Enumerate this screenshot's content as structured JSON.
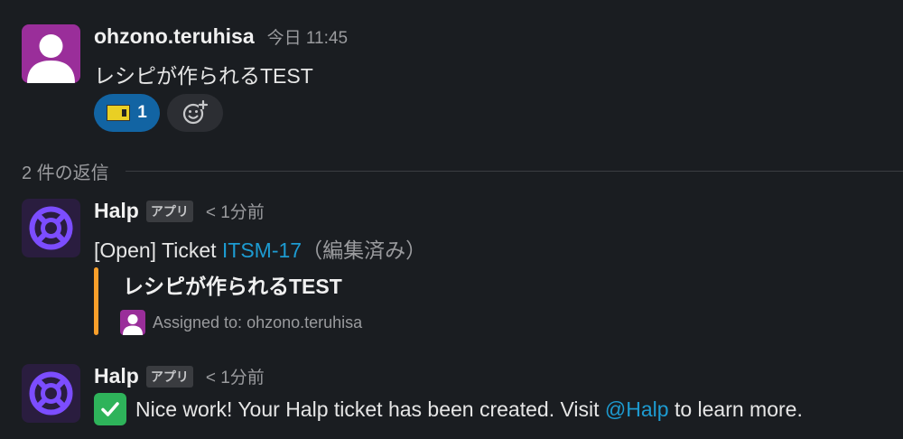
{
  "colors": {
    "background": "#1a1d21",
    "link": "#1d9bd1",
    "attachment_bar": "#f99f2a",
    "user_avatar": "#9a2e9a",
    "halp_avatar": "#7c4dff",
    "reaction_active": "#1264a3"
  },
  "parent_message": {
    "sender": "ohzono.teruhisa",
    "time": "今日 11:45",
    "text": "レシピが作られるTEST",
    "reactions": [
      {
        "icon": "ticket-emoji-icon",
        "count": "1"
      }
    ],
    "add_reaction_icon": "add-reaction-icon"
  },
  "thread": {
    "reply_count": "2 件の返信"
  },
  "replies": [
    {
      "sender": "Halp",
      "badge": "アプリ",
      "time": "< 1分前",
      "text_prefix": "[Open] Ticket ",
      "ticket_link": "ITSM-17",
      "edited": "（編集済み）",
      "attachment": {
        "title": "レシピが作られるTEST",
        "assigned": "Assigned to: ohzono.teruhisa"
      }
    },
    {
      "sender": "Halp",
      "badge": "アプリ",
      "time": "< 1分前",
      "emoji": "white-check-mark-icon",
      "text_prefix": "Nice work! Your Halp ticket has been created. Visit ",
      "mention": "@Halp",
      "text_suffix": " to learn more."
    }
  ]
}
